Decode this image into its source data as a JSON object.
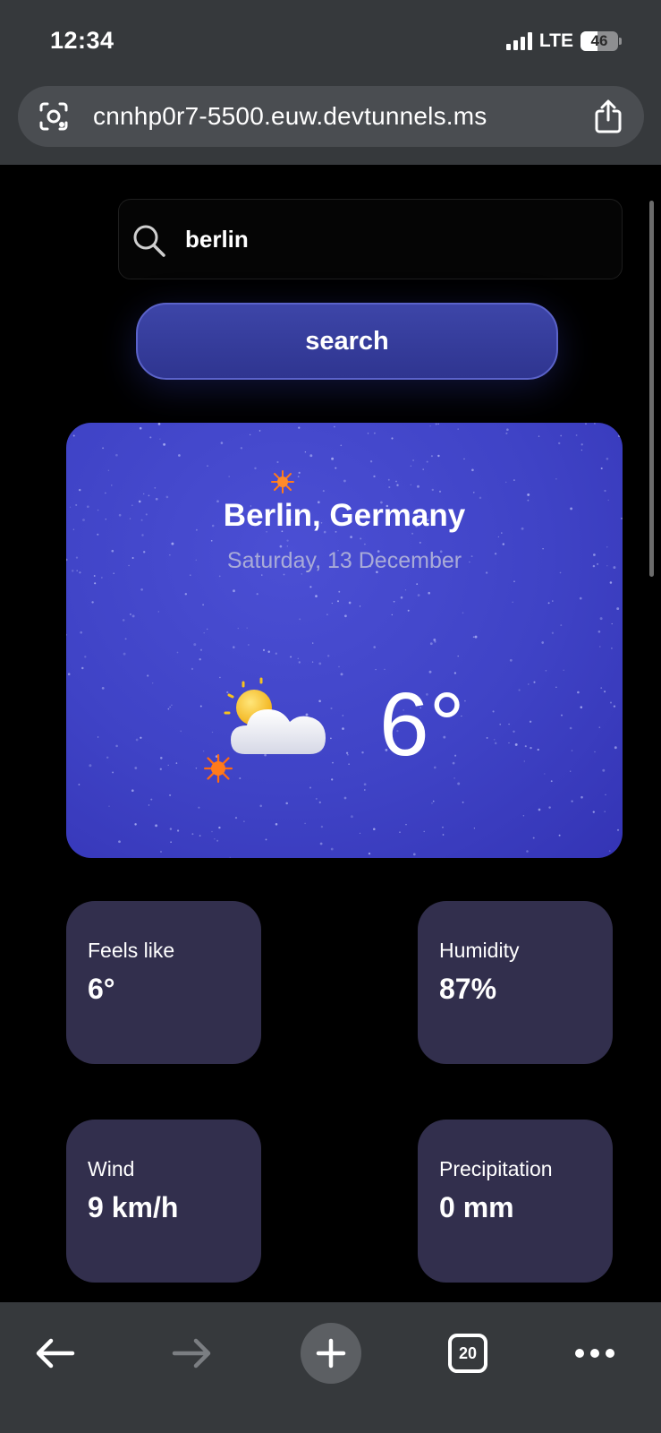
{
  "status_bar": {
    "time": "12:34",
    "network": "LTE",
    "battery": "46",
    "battery_level": 0.46
  },
  "browser": {
    "url": "cnnhp0r7-5500.euw.devtunnels.ms",
    "tab_count": "20"
  },
  "search": {
    "value": "berlin",
    "button_label": "search"
  },
  "weather": {
    "location": "Berlin, Germany",
    "date": "Saturday, 13 December",
    "temperature": "6°",
    "icon": "partly-cloudy-icon"
  },
  "stats": [
    {
      "label": "Feels like",
      "value": "6°"
    },
    {
      "label": "Humidity",
      "value": "87%"
    },
    {
      "label": "Wind",
      "value": "9 km/h"
    },
    {
      "label": "Precipitation",
      "value": "0 mm"
    }
  ],
  "colors": {
    "card": "#4045c6",
    "stat_card": "#322f4d",
    "button": "#363da0",
    "browser_chrome": "#36393c"
  }
}
